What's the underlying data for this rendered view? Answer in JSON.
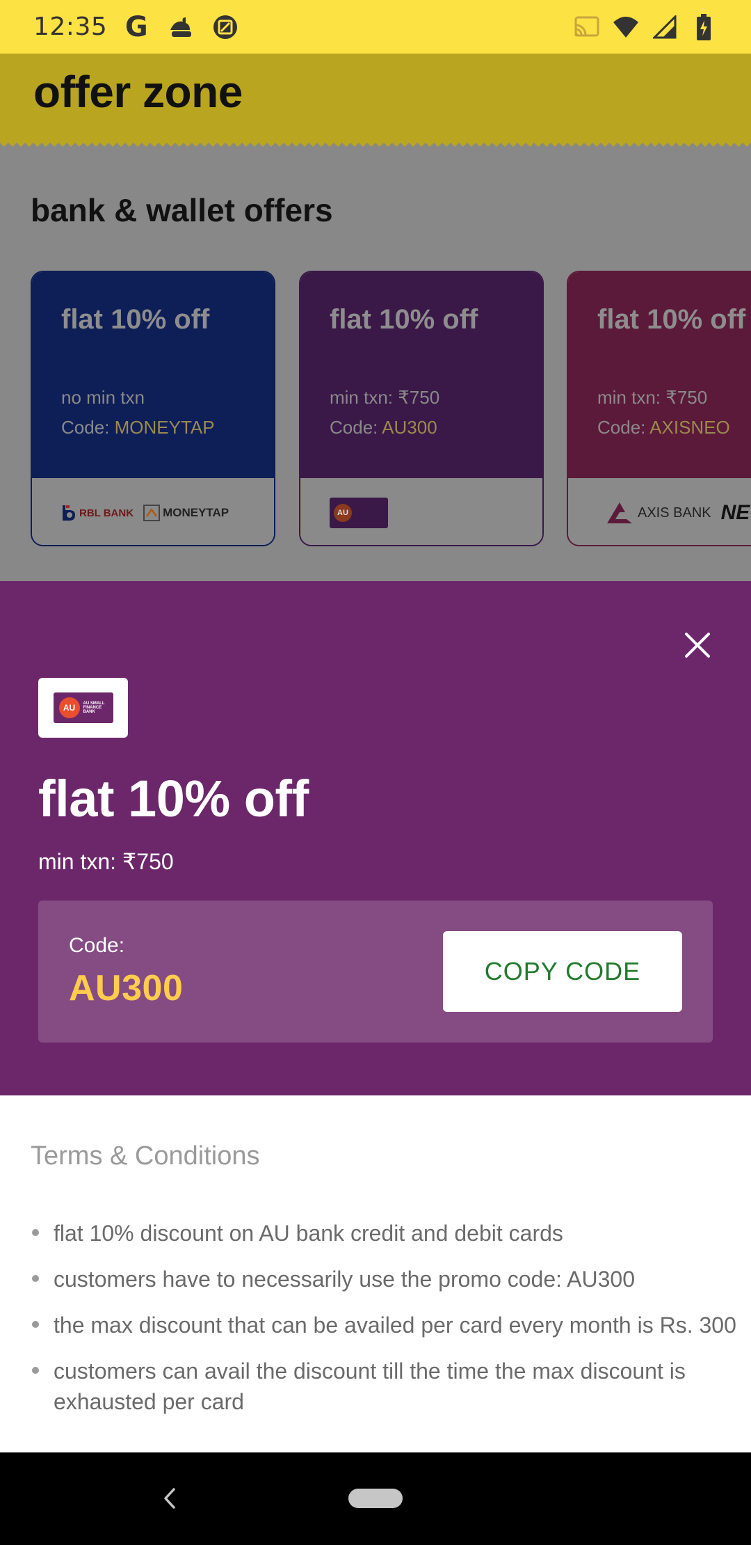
{
  "status_bar": {
    "time": "12:35",
    "left_icons": [
      "google-g-icon",
      "sushi-notification-icon",
      "screenshot-icon"
    ],
    "right_icons": [
      "cast-icon",
      "wifi-icon",
      "signal-icon",
      "battery-charging-icon"
    ]
  },
  "page": {
    "header_title": "offer zone",
    "header_color": "#fde244",
    "section_title": "bank & wallet offers",
    "cards": [
      {
        "title": "flat 10% off",
        "min_txn": "no min txn",
        "code_label": "Code: ",
        "code": "MONEYTAP",
        "logos": [
          "RBL BANK",
          "MONEYTAP"
        ],
        "color": "#0e1e57"
      },
      {
        "title": "flat 10% off",
        "min_txn": "min txn: ₹750",
        "code_label": "Code: ",
        "code": "AU300",
        "logos": [
          "AU"
        ],
        "color": "#3a1848"
      },
      {
        "title": "flat 10% off",
        "min_txn": "min txn: ₹750",
        "code_label": "Code: ",
        "code": "AXISNEO",
        "logos": [
          "AXIS BANK",
          "NEO"
        ],
        "color": "#5c1a3a"
      }
    ]
  },
  "sheet": {
    "bank_logo": {
      "short": "AU",
      "name": "AU SMALL FINANCE BANK"
    },
    "title": "flat 10% off",
    "min_txn": "min txn: ₹750",
    "code_label": "Code:",
    "code": "AU300",
    "copy_button": "COPY CODE",
    "accent_color": "#6c276b",
    "code_color": "#ffcc4d",
    "copy_text_color": "#227a2c",
    "terms_title": "Terms & Conditions",
    "terms": [
      "flat 10% discount on AU bank credit and debit cards",
      "customers have to necessarily use the promo code: AU300",
      "the max discount that can be availed per card every month is Rs. 300",
      "customers can avail the discount till the time the max discount is exhausted per card"
    ]
  },
  "nav_bar": {
    "back_icon": "back-chevron-icon",
    "home_icon": "home-pill-icon"
  }
}
